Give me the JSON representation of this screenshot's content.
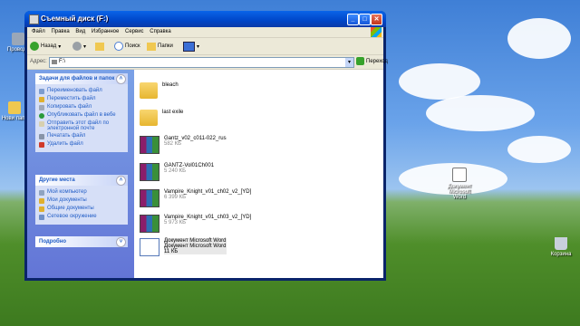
{
  "desktop": {
    "icons": [
      {
        "label": "Проводн"
      },
      {
        "label": "Нови папк"
      },
      {
        "label": "Документ Microsoft Word"
      },
      {
        "label": "Корзина"
      }
    ]
  },
  "window": {
    "title": "Съемный диск (F:)",
    "controls": {
      "minimize": "_",
      "maximize": "□",
      "close": "✕"
    },
    "menu": [
      "Файл",
      "Правка",
      "Вид",
      "Избранное",
      "Сервис",
      "Справка"
    ],
    "toolbar": {
      "back_label": "Назад",
      "search_label": "Поиск",
      "folders_label": "Папки"
    },
    "address": {
      "label": "Адрес:",
      "value": "F:\\",
      "go_label": "Переход"
    },
    "tasks_panel": {
      "title": "Задачи для файлов и папок",
      "items": [
        "Переименовать файл",
        "Переместить файл",
        "Копировать файл",
        "Опубликовать файл в вебе",
        "Отправить этот файл по электронной почте",
        "Печатать файл",
        "Удалить файл"
      ]
    },
    "places_panel": {
      "title": "Другие места",
      "items": [
        "Мой компьютер",
        "Мои документы",
        "Общие документы",
        "Сетевое окружение"
      ]
    },
    "details_panel": {
      "title": "Подробно"
    },
    "files": [
      {
        "name": "bleach",
        "size": "",
        "kind": "folder"
      },
      {
        "name": "last exile",
        "size": "",
        "kind": "folder"
      },
      {
        "name": "Gantz_v02_c011-022_rus",
        "size": "582 КБ",
        "kind": "rar"
      },
      {
        "name": "GANTZ-Vol01Ch001",
        "size": "5 240 КБ",
        "kind": "rar"
      },
      {
        "name": "Vampire_Knight_v01_ch02_v2_[YD]",
        "size": "6 399 КБ",
        "kind": "rar"
      },
      {
        "name": "Vampire_Knight_v01_ch03_v2_[YD]",
        "size": "5 973 КБ",
        "kind": "rar"
      },
      {
        "name": "Документ Microsoft Word",
        "type": "Документ Microsoft Word",
        "size": "11 КБ",
        "kind": "doc"
      }
    ]
  },
  "colors": {
    "title_blue": "#0046c8",
    "panel_blue": "#215dc6",
    "sky": "#3f7fd6",
    "grass": "#4f8e2a"
  }
}
